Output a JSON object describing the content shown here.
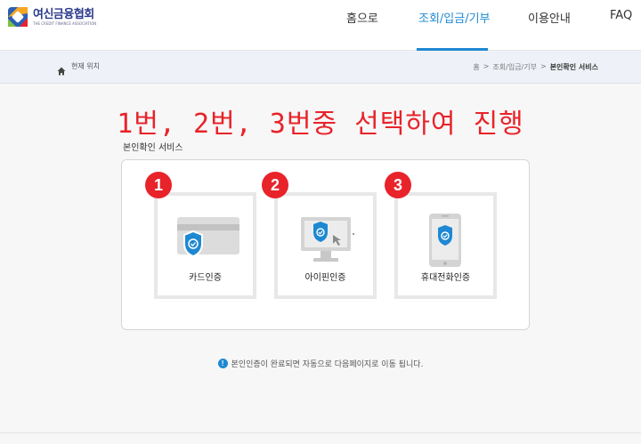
{
  "header": {
    "logo_title": "여신금융협회",
    "logo_sub": "THE CREDIT FINANCE ASSOCIATION",
    "nav": [
      {
        "label": "홈으로"
      },
      {
        "label": "조회/입금/기부"
      },
      {
        "label": "이용안내"
      },
      {
        "label": "FAQ"
      }
    ]
  },
  "breadcrumb": {
    "current_location_label": "현재 위치",
    "path": [
      "홈",
      ">",
      "조회/입금/기부",
      ">",
      "본인확인 서비스"
    ]
  },
  "instruction": "1번, 2번, 3번중 선택하여 진행",
  "section_title": "본인확인 서비스",
  "options": [
    {
      "number": "1",
      "label": "카드인증",
      "icon": "credit-card-shield-icon"
    },
    {
      "number": "2",
      "label": "아이핀인증",
      "icon": "monitor-shield-icon"
    },
    {
      "number": "3",
      "label": "휴대전화인증",
      "icon": "mobile-phone-shield-icon"
    }
  ],
  "note": "본인인증이 완료되면 자동으로 다음페이지로 이동 됩니다.",
  "colors": {
    "accent": "#1e88d2",
    "badge": "#e8232a",
    "shield": "#1e88d2",
    "brand": "#2b3a8c"
  }
}
